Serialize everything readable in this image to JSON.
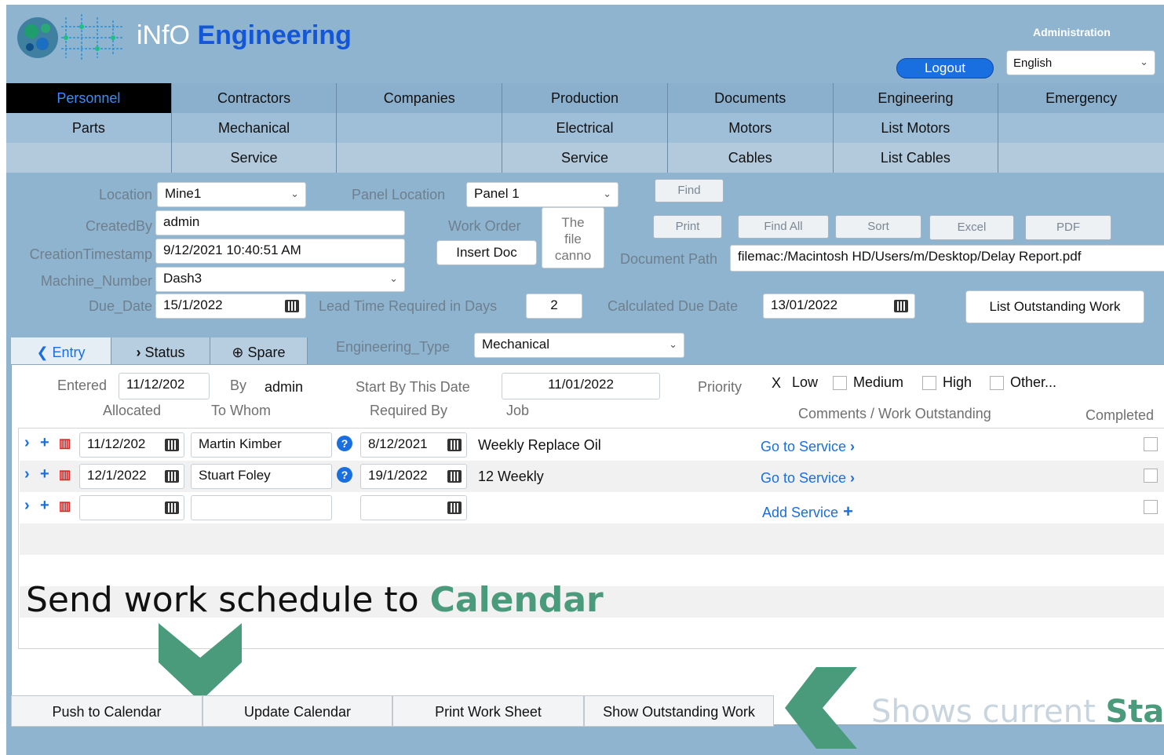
{
  "header": {
    "app_prefix": "iNfO ",
    "app_name": "Engineering",
    "admin_label": "Administration",
    "logout_label": "Logout",
    "language": "English"
  },
  "nav": {
    "row1": [
      "Personnel",
      "Contractors",
      "Companies",
      "Production",
      "Documents",
      "Engineering",
      "Emergency"
    ],
    "row2": [
      "Parts",
      "Mechanical",
      "",
      "Electrical",
      "Motors",
      "List Motors",
      ""
    ],
    "row3": [
      "",
      "Service",
      "",
      "Service",
      "Cables",
      "List Cables",
      ""
    ],
    "active": "Personnel"
  },
  "form": {
    "location_label": "Location",
    "location_value": "Mine1",
    "panel_location_label": "Panel Location",
    "panel_location_value": "Panel 1",
    "find_label": "Find",
    "created_by_label": "CreatedBy",
    "created_by_value": "admin",
    "work_order_label": "Work Order",
    "file_preview_text": "The file canno",
    "insert_doc_label": "Insert Doc",
    "print_label": "Print",
    "find_all_label": "Find All",
    "sort_label": "Sort",
    "excel_label": "Excel",
    "pdf_label": "PDF",
    "creation_ts_label": "CreationTimestamp",
    "creation_ts_value": "9/12/2021 10:40:51 AM",
    "document_path_label": "Document Path",
    "document_path_value": "filemac:/Macintosh HD/Users/m/Desktop/Delay Report.pdf",
    "machine_number_label": "Machine_Number",
    "machine_number_value": "Dash3",
    "due_date_label": "Due_Date",
    "due_date_value": "15/1/2022",
    "lead_time_label": "Lead Time Required in Days",
    "lead_time_value": "2",
    "calc_due_label": "Calculated Due Date",
    "calc_due_value": "13/01/2022",
    "list_outstanding_label": "List Outstanding Work"
  },
  "tabs": {
    "entry": "Entry",
    "status": "Status",
    "spare": "Spare",
    "eng_type_label": "Engineering_Type",
    "eng_type_value": "Mechanical"
  },
  "panel": {
    "entered_label": "Entered",
    "entered_value": "11/12/202",
    "by_label": "By",
    "by_value": "admin",
    "start_by_label": "Start By This Date",
    "start_by_value": "11/01/2022",
    "priority_label": "Priority",
    "priority_options": [
      "Low",
      "Medium",
      "High",
      "Other..."
    ],
    "priority_checked_mark": "X",
    "col_allocated": "Allocated",
    "col_to_whom": "To Whom",
    "col_required_by": "Required By",
    "col_job": "Job",
    "col_comments": "Comments / Work Outstanding",
    "col_completed": "Completed",
    "rows": [
      {
        "allocated": "11/12/202",
        "to_whom": "Martin Kimber",
        "required_by": "8/12/2021",
        "job": "Weekly Replace Oil",
        "link": "Go to Service"
      },
      {
        "allocated": "12/1/2022",
        "to_whom": "Stuart Foley",
        "required_by": "19/1/2022",
        "job": "12 Weekly",
        "link": "Go to Service"
      },
      {
        "allocated": "",
        "to_whom": "",
        "required_by": "",
        "job": "",
        "link": "Add Service"
      }
    ]
  },
  "annotations": {
    "calendar_prefix": "Send work schedule to ",
    "calendar_word": "Calendar",
    "status_prefix": "Shows current ",
    "status_word": "Statu",
    "accent_color": "#4a9a7c"
  },
  "bottom": {
    "push": "Push to Calendar",
    "update": "Update Calendar",
    "print_sheet": "Print Work Sheet",
    "show_outstanding": "Show Outstanding Work"
  }
}
